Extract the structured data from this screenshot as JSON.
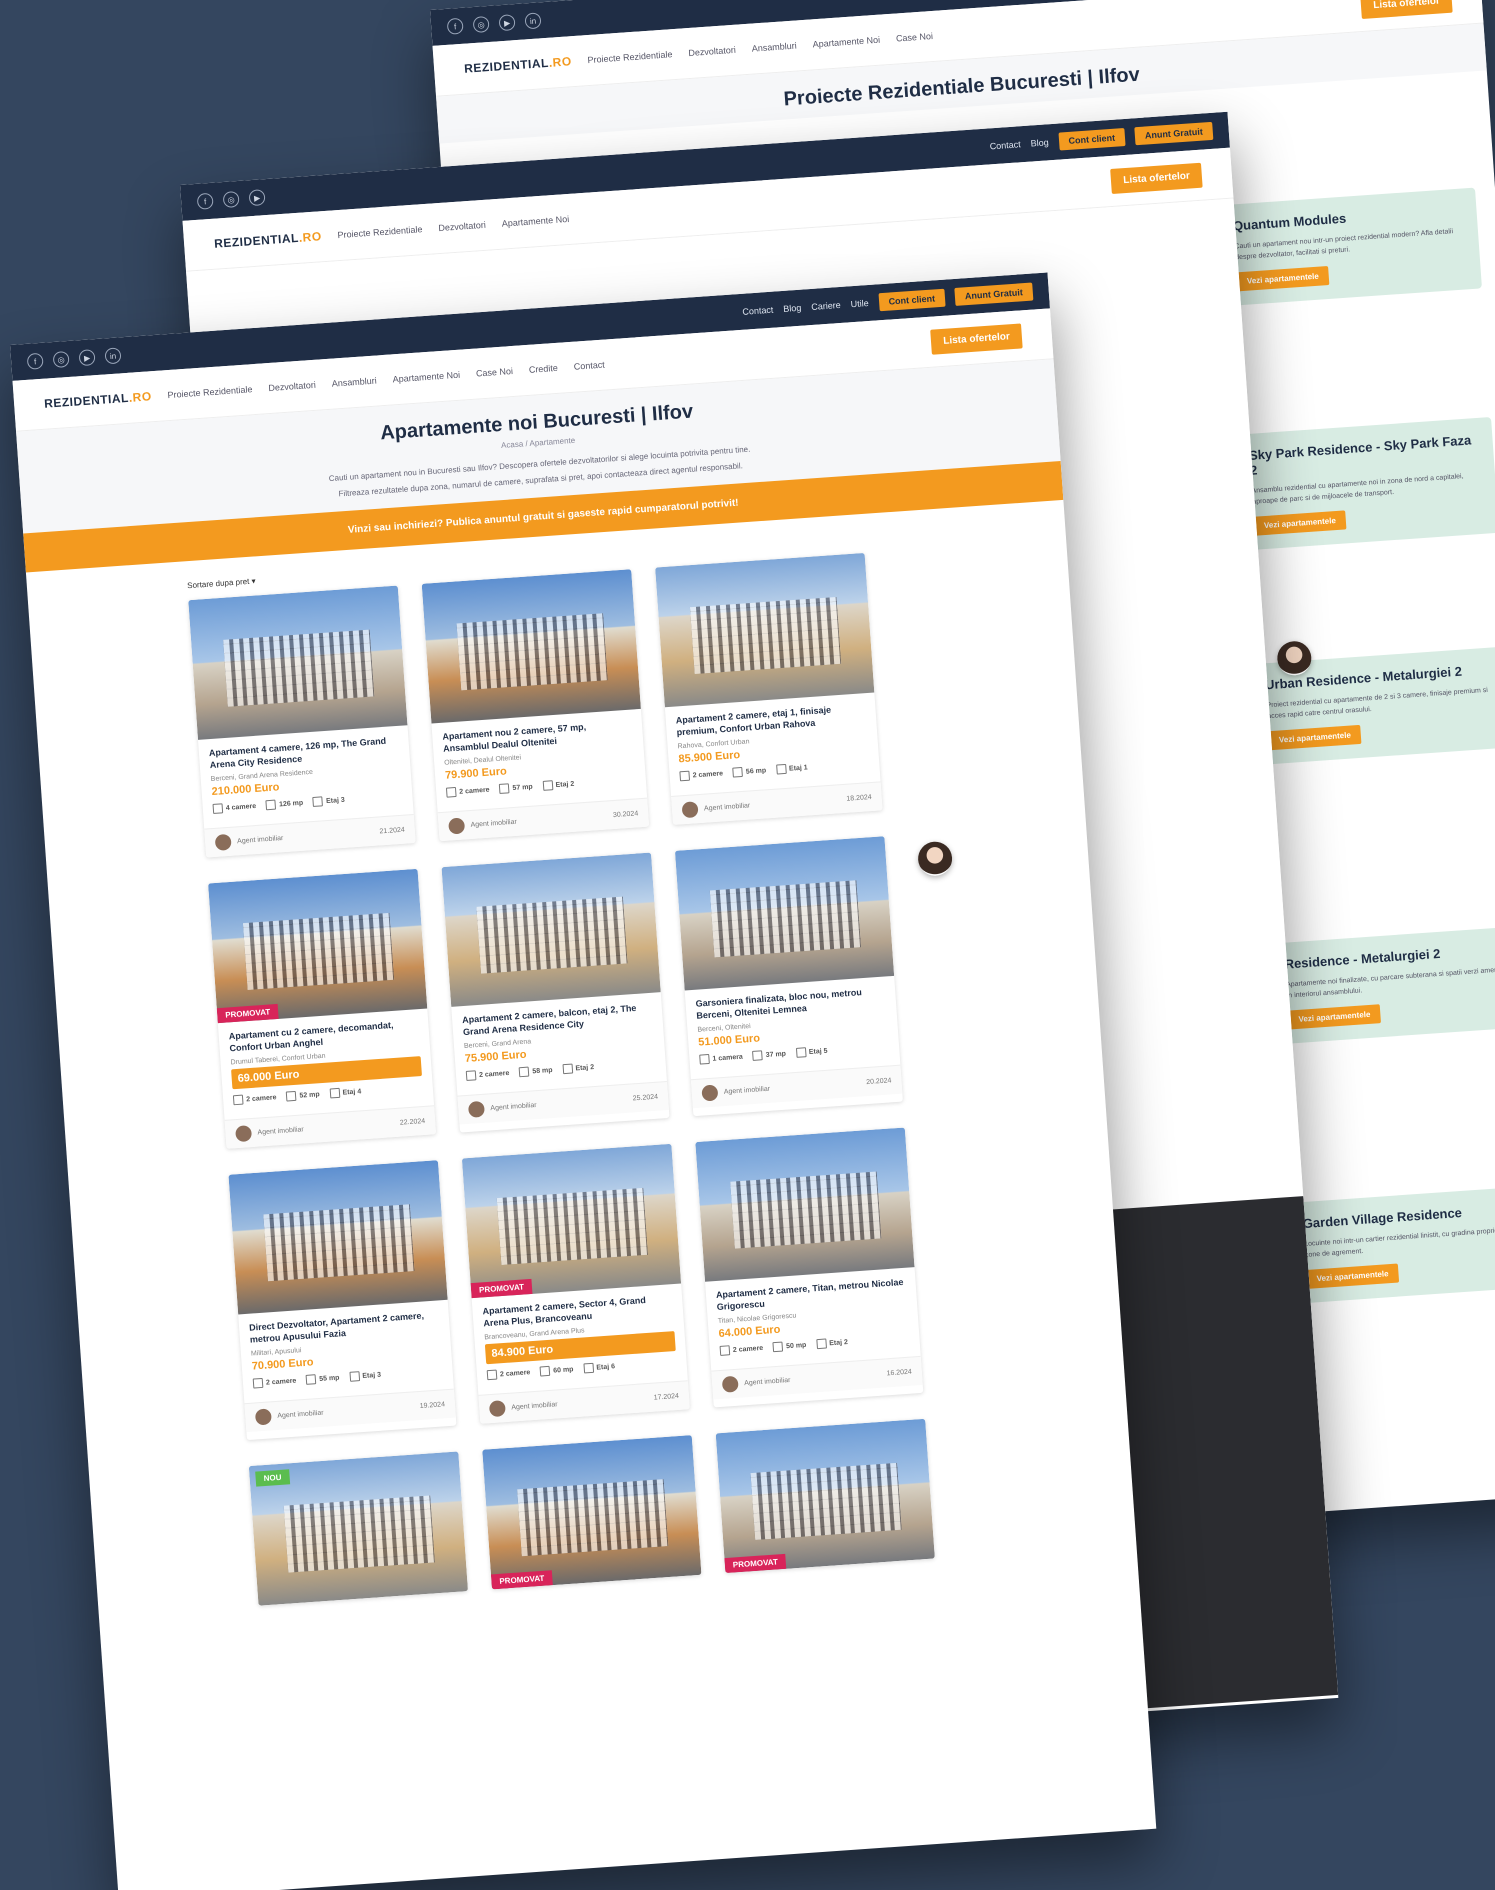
{
  "topbar": {
    "links": [
      "Contact",
      "Blog",
      "Cariere",
      "Utile"
    ],
    "btn_login": "Cont client",
    "btn_cta": "Anunt Gratuit"
  },
  "nav": {
    "logo_main": "REZIDENTIAL",
    "logo_accent": ".RO",
    "items": [
      "Proiecte Rezidentiale",
      "Dezvoltatori",
      "Ansambluri",
      "Apartamente Noi",
      "Case Noi",
      "Credite",
      "Contact"
    ],
    "list_button": "Lista ofertelor"
  },
  "page_back": {
    "title": "Proiecte Rezidentiale Bucuresti | Ilfov",
    "projects": [
      {
        "name": "Quantum Modules",
        "text": "Cauti un apartament nou intr-un proiect rezidential modern? Afla detalii despre dezvoltator, facilitati si preturi.",
        "button": "Vezi apartamentele"
      },
      {
        "name": "Sky Park Residence - Sky Park Faza 2",
        "text": "Ansamblu rezidential cu apartamente noi in zona de nord a capitalei, aproape de parc si de mijloacele de transport.",
        "button": "Vezi apartamentele"
      },
      {
        "name": "Urban Residence - Metalurgiei 2",
        "text": "Proiect rezidential cu apartamente de 2 si 3 camere, finisaje premium si acces rapid catre centrul orasului.",
        "button": "Vezi apartamentele"
      },
      {
        "name": "Residence - Metalurgiei 2",
        "text": "Apartamente noi finalizate, cu parcare subterana si spatii verzi amenajate in interiorul ansamblului.",
        "button": "Vezi apartamentele"
      },
      {
        "name": "Garden Village Residence",
        "text": "Locuinte noi intr-un cartier rezidential linistit, cu gradina proprie si acces la zone de agrement.",
        "button": "Vezi apartamentele"
      }
    ]
  },
  "page_front": {
    "title": "Apartamente noi Bucuresti | Ilfov",
    "crumbs": "Acasa / Apartamente",
    "intro": [
      "Cauti un apartament nou in Bucuresti sau Ilfov? Descopera ofertele dezvoltatorilor si alege locuinta potrivita pentru tine.",
      "Filtreaza rezultatele dupa zona, numarul de camere, suprafata si pret, apoi contacteaza direct agentul responsabil."
    ],
    "band_text": "Vinzi sau inchiriezi? Publica anuntul gratuit si gaseste rapid cumparatorul potrivit!",
    "sort_label": "Sortare dupa pret",
    "featured_label": "PROMOVAT",
    "new_label": "NOU",
    "listings": [
      {
        "title": "Apartament 4 camere, 126 mp, The Grand Arena City Residence",
        "location": "Berceni, Grand Arena Residence",
        "price": "210.000 Euro",
        "rooms": "4 camere",
        "area": "126 mp",
        "floor": "Etaj 3",
        "agent": "Agent imobiliar",
        "date": "21.2024"
      },
      {
        "title": "Apartament nou 2 camere, 57 mp, Ansamblul Dealul Oltenitei",
        "location": "Oltenitei, Dealul Oltenitei",
        "price": "79.900 Euro",
        "rooms": "2 camere",
        "area": "57 mp",
        "floor": "Etaj 2",
        "agent": "Agent imobiliar",
        "date": "30.2024"
      },
      {
        "title": "Apartament 2 camere, etaj 1, finisaje premium, Confort Urban Rahova",
        "location": "Rahova, Confort Urban",
        "price": "85.900 Euro",
        "rooms": "2 camere",
        "area": "56 mp",
        "floor": "Etaj 1",
        "agent": "Agent imobiliar",
        "date": "18.2024"
      },
      {
        "title": "Apartament cu 2 camere, decomandat, Confort Urban Anghel",
        "location": "Drumul Taberei, Confort Urban",
        "price": "69.000 Euro",
        "rooms": "2 camere",
        "area": "52 mp",
        "floor": "Etaj 4",
        "agent": "Agent imobiliar",
        "date": "22.2024",
        "featured": true
      },
      {
        "title": "Apartament 2 camere, balcon, etaj 2, The Grand Arena Residence City",
        "location": "Berceni, Grand Arena",
        "price": "75.900 Euro",
        "rooms": "2 camere",
        "area": "58 mp",
        "floor": "Etaj 2",
        "agent": "Agent imobiliar",
        "date": "25.2024"
      },
      {
        "title": "Garsoniera finalizata, bloc nou, metrou Berceni, Oltenitei Lemnea",
        "location": "Berceni, Oltenitei",
        "price": "51.000 Euro",
        "rooms": "1 camera",
        "area": "37 mp",
        "floor": "Etaj 5",
        "agent": "Agent imobiliar",
        "date": "20.2024"
      },
      {
        "title": "Direct Dezvoltator, Apartament 2 camere, metrou Apusului Fazia",
        "location": "Militari, Apusului",
        "price": "70.900 Euro",
        "rooms": "2 camere",
        "area": "55 mp",
        "floor": "Etaj 3",
        "agent": "Agent imobiliar",
        "date": "19.2024"
      },
      {
        "title": "Apartament 2 camere, Sector 4, Grand Arena Plus, Brancoveanu",
        "location": "Brancoveanu, Grand Arena Plus",
        "price": "84.900 Euro",
        "rooms": "2 camere",
        "area": "60 mp",
        "floor": "Etaj 6",
        "agent": "Agent imobiliar",
        "date": "17.2024",
        "featured": true
      },
      {
        "title": "Apartament 2 camere, Titan, metrou Nicolae Grigorescu",
        "location": "Titan, Nicolae Grigorescu",
        "price": "64.000 Euro",
        "rooms": "2 camere",
        "area": "50 mp",
        "floor": "Etaj 2",
        "agent": "Agent imobiliar",
        "date": "16.2024"
      }
    ]
  },
  "colors": {
    "navy": "#1f2d45",
    "accent": "#f39a1f",
    "promo": "#d8245a",
    "background": "#34465f"
  }
}
